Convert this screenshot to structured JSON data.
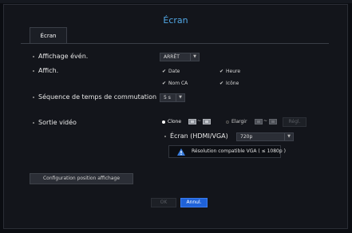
{
  "title": "Écran",
  "tab_label": "Écran",
  "settings": {
    "event_display": {
      "label": "Affichage évén.",
      "value": "ARRÊT"
    },
    "display": {
      "label": "Affich.",
      "checkboxes": [
        {
          "label": "Date",
          "checked": true
        },
        {
          "label": "Heure",
          "checked": true
        },
        {
          "label": "Nom CA",
          "checked": true
        },
        {
          "label": "Icône",
          "checked": true
        }
      ]
    },
    "switch_sequence": {
      "label": "Séquence de temps de commutation",
      "value": "5 s"
    },
    "video_out": {
      "label": "Sortie vidéo",
      "clone_label": "Clone",
      "extend_label": "Elargir",
      "settings_button": "Régl.",
      "screen_label": "Écran (HDMI/VGA)",
      "screen_value": "720p",
      "notice": "Résolution compatible VGA ( ≤ 1080p )"
    }
  },
  "position_config_button": "Configuration position affichage",
  "footer": {
    "ok": "OK",
    "cancel": "Annul."
  },
  "colors": {
    "accent_title": "#52a8e6",
    "primary_button": "#1f62d8",
    "warning_icon": "#3b7fe0"
  },
  "icons": {
    "check": "check-icon",
    "dropdown": "chevron-down-icon",
    "warning": "warning-triangle-icon",
    "monitor": "monitor-icon"
  }
}
